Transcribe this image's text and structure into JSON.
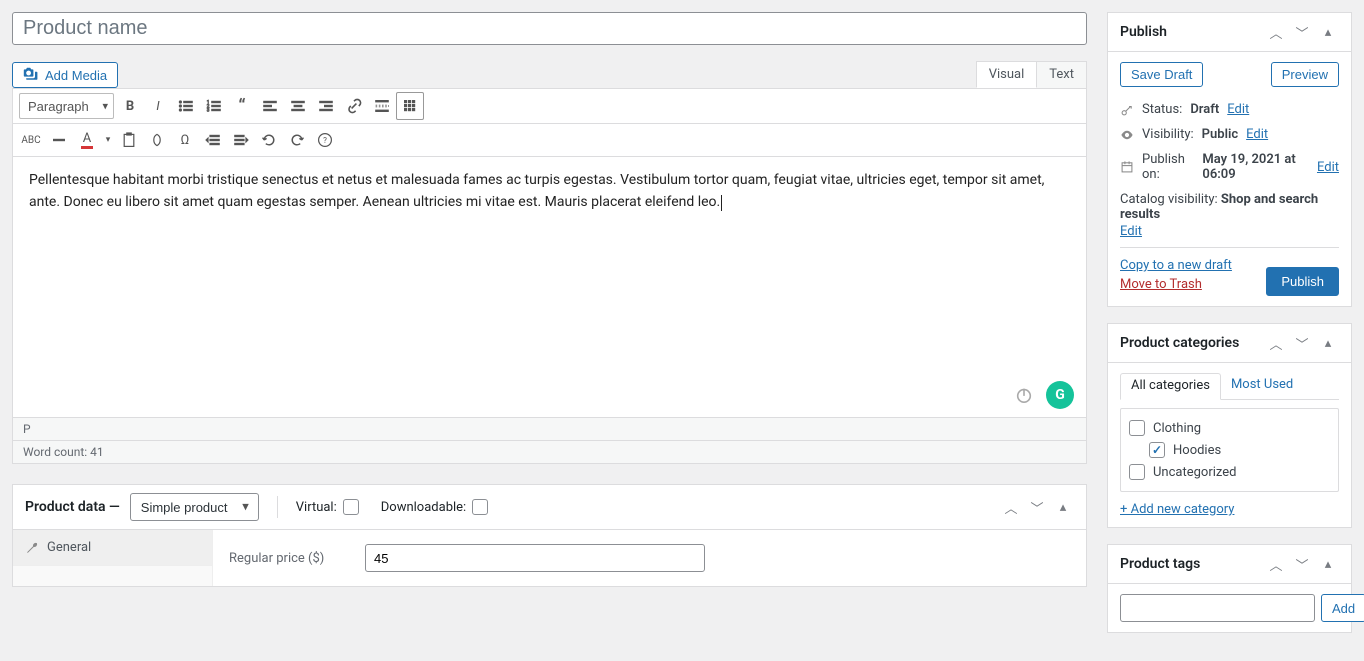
{
  "title_placeholder": "Product name",
  "add_media_label": "Add Media",
  "editor": {
    "tabs": {
      "visual": "Visual",
      "text": "Text"
    },
    "format_selector": "Paragraph",
    "content": "Pellentesque habitant morbi tristique senectus et netus et malesuada fames ac turpis egestas. Vestibulum tortor quam, feugiat vitae, ultricies eget, tempor sit amet, ante. Donec eu libero sit amet quam egestas semper. Aenean ultricies mi vitae est. Mauris placerat eleifend leo.",
    "path": "P",
    "word_count_label": "Word count: 41"
  },
  "product_data": {
    "title": "Product data",
    "type": "Simple product",
    "virtual_label": "Virtual:",
    "downloadable_label": "Downloadable:",
    "tabs": {
      "general": "General"
    },
    "regular_price_label": "Regular price ($)",
    "regular_price_value": "45"
  },
  "publish": {
    "title": "Publish",
    "save_draft": "Save Draft",
    "preview": "Preview",
    "status_label": "Status:",
    "status_value": "Draft",
    "visibility_label": "Visibility:",
    "visibility_value": "Public",
    "publish_on_label": "Publish on:",
    "publish_on_value": "May 19, 2021 at 06:09",
    "catalog_label": "Catalog visibility:",
    "catalog_value": "Shop and search results",
    "edit": "Edit",
    "copy_draft": "Copy to a new draft",
    "move_trash": "Move to Trash",
    "publish_button": "Publish"
  },
  "categories": {
    "title": "Product categories",
    "tab_all": "All categories",
    "tab_most": "Most Used",
    "items": [
      {
        "label": "Clothing",
        "checked": false,
        "child": false
      },
      {
        "label": "Hoodies",
        "checked": true,
        "child": true
      },
      {
        "label": "Uncategorized",
        "checked": false,
        "child": false
      }
    ],
    "add_new": "+ Add new category"
  },
  "tags": {
    "title": "Product tags",
    "add": "Add"
  }
}
